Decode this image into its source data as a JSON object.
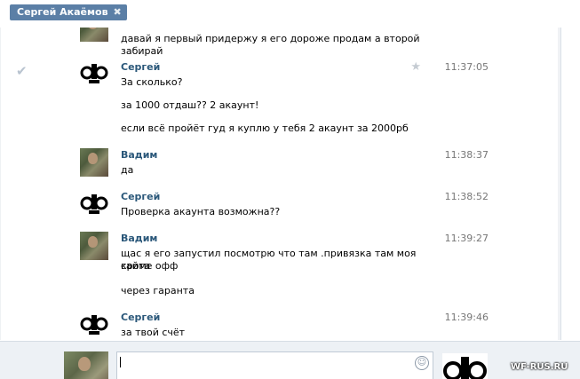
{
  "header": {
    "contact_chip": "Сергей Акаёмов",
    "close_glyph": "✖"
  },
  "messages": [
    {
      "id": "m0",
      "author": "",
      "time": "",
      "avatar": "photo",
      "lines": [
        "давай я первый придержу я его дороже продам а второй забирай"
      ]
    },
    {
      "id": "m1",
      "author": "Сергей",
      "time": "11:37:05",
      "avatar": "dub",
      "lines": [
        "За сколько?",
        "за 1000 отдаш?? 2 акаунт!",
        "если всё пройёт гуд я куплю у тебя 2 акаунт за 2000рб"
      ]
    },
    {
      "id": "m2",
      "author": "Вадим",
      "time": "11:38:37",
      "avatar": "photo",
      "lines": [
        "да"
      ]
    },
    {
      "id": "m3",
      "author": "Сергей",
      "time": "11:38:52",
      "avatar": "dub",
      "lines": [
        "Проверка акаунта возможна??"
      ]
    },
    {
      "id": "m4",
      "author": "Вадим",
      "time": "11:39:27",
      "avatar": "photo",
      "lines": [
        "щас я его запустил посмотрю что там .привязка там моя кроме офф",
        "сайта",
        "через гаранта"
      ]
    },
    {
      "id": "m5",
      "author": "Сергей",
      "time": "11:39:46",
      "avatar": "dub",
      "lines": [
        "за твой счёт"
      ]
    }
  ],
  "icons": {
    "read_check": "✔",
    "favorite_star": "★",
    "smiley": "☺"
  },
  "composer": {
    "value": ""
  },
  "watermark": "WF-RUS.RU",
  "colors": {
    "chip": "#5b7fa6",
    "author": "#2b587a",
    "composer_bg": "#edf1f5"
  }
}
